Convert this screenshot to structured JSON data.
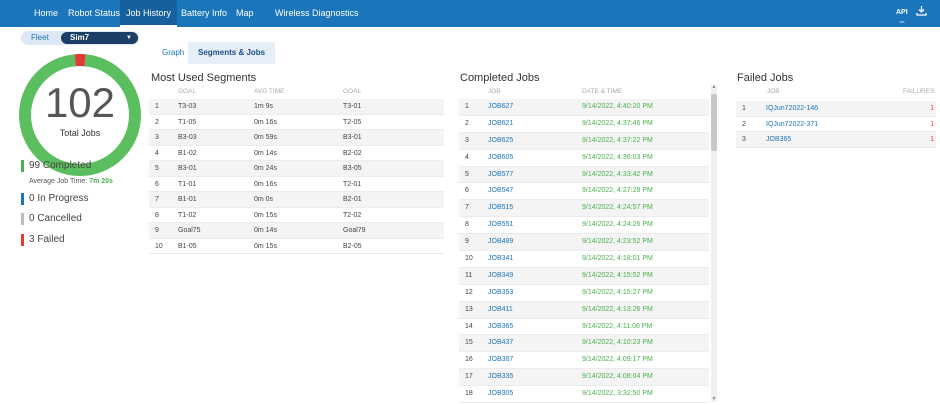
{
  "nav": {
    "tabs": [
      {
        "label": "Home"
      },
      {
        "label": "Robot Status"
      },
      {
        "label": "Job History"
      },
      {
        "label": "Battery Info"
      },
      {
        "label": "Map"
      },
      {
        "label": "Wireless Diagnostics"
      }
    ],
    "api_label": "API",
    "download_icon": "download-icon",
    "accent": "#1b75bb"
  },
  "fleet": {
    "label": "Fleet",
    "selected": "Sim7"
  },
  "summary": {
    "total": "102",
    "total_label": "Total Jobs",
    "completed_count": 99,
    "failed_count": 3,
    "completed": "99 Completed",
    "avg_label": "Average Job Time:",
    "avg_value": "7m 20s",
    "in_progress": "0 In Progress",
    "cancelled": "0 Cancelled",
    "failed": "3 Failed",
    "colors": {
      "completed": "#4caf50",
      "in_progress": "#1b75bb",
      "cancelled": "#bdbdbd",
      "failed": "#e53935"
    }
  },
  "subtabs": {
    "graph": "Graph",
    "segments": "Segments & Jobs"
  },
  "segments": {
    "title": "Most Used Segments",
    "headers": {
      "goal1": "GOAL",
      "avg": "AVG TIME",
      "goal2": "GOAL"
    },
    "rows": [
      {
        "n": "1",
        "from": "T3-03",
        "avg": "1m 9s",
        "to": "T3-01"
      },
      {
        "n": "2",
        "from": "T1-05",
        "avg": "0m 16s",
        "to": "T2-05"
      },
      {
        "n": "3",
        "from": "B3-03",
        "avg": "0m 59s",
        "to": "B3-01"
      },
      {
        "n": "4",
        "from": "B1-02",
        "avg": "0m 14s",
        "to": "B2-02"
      },
      {
        "n": "5",
        "from": "B3-01",
        "avg": "0m 24s",
        "to": "B3-05"
      },
      {
        "n": "6",
        "from": "T1-01",
        "avg": "0m 16s",
        "to": "T2-01"
      },
      {
        "n": "7",
        "from": "B1-01",
        "avg": "0m 0s",
        "to": "B2-01"
      },
      {
        "n": "8",
        "from": "T1-02",
        "avg": "0m 15s",
        "to": "T2-02"
      },
      {
        "n": "9",
        "from": "Goal75",
        "avg": "0m 14s",
        "to": "Goal79"
      },
      {
        "n": "10",
        "from": "B1-05",
        "avg": "0m 15s",
        "to": "B2-05"
      }
    ]
  },
  "completed_jobs": {
    "title": "Completed Jobs",
    "headers": {
      "job": "JOB",
      "date": "DATE & TIME"
    },
    "rows": [
      {
        "n": "1",
        "job": "JOB627",
        "date": "9/14/2022, 4:40:20 PM"
      },
      {
        "n": "2",
        "job": "JOB621",
        "date": "9/14/2022, 4:37:46 PM"
      },
      {
        "n": "3",
        "job": "JOB625",
        "date": "9/14/2022, 4:37:22 PM"
      },
      {
        "n": "4",
        "job": "JOB605",
        "date": "9/14/2022, 4:36:03 PM"
      },
      {
        "n": "5",
        "job": "JOB577",
        "date": "9/14/2022, 4:33:42 PM"
      },
      {
        "n": "6",
        "job": "JOB547",
        "date": "9/14/2022, 4:27:28 PM"
      },
      {
        "n": "7",
        "job": "JOB515",
        "date": "9/14/2022, 4:24:57 PM"
      },
      {
        "n": "8",
        "job": "JOB551",
        "date": "9/14/2022, 4:24:26 PM"
      },
      {
        "n": "9",
        "job": "JOB489",
        "date": "9/14/2022, 4:23:52 PM"
      },
      {
        "n": "10",
        "job": "JOB341",
        "date": "9/14/2022, 4:18:01 PM"
      },
      {
        "n": "11",
        "job": "JOB349",
        "date": "9/14/2022, 4:15:52 PM"
      },
      {
        "n": "12",
        "job": "JOB353",
        "date": "9/14/2022, 4:15:27 PM"
      },
      {
        "n": "13",
        "job": "JOB411",
        "date": "9/14/2022, 4:13:26 PM"
      },
      {
        "n": "14",
        "job": "JOB365",
        "date": "9/14/2022, 4:11:08 PM"
      },
      {
        "n": "15",
        "job": "JOB437",
        "date": "9/14/2022, 4:10:23 PM"
      },
      {
        "n": "16",
        "job": "JOB387",
        "date": "9/14/2022, 4:09:17 PM"
      },
      {
        "n": "17",
        "job": "JOB335",
        "date": "9/14/2022, 4:08:04 PM"
      },
      {
        "n": "18",
        "job": "JOB305",
        "date": "9/14/2022, 3:32:50 PM"
      }
    ]
  },
  "failed_jobs": {
    "title": "Failed Jobs",
    "headers": {
      "job": "JOB",
      "failures": "FAILURES"
    },
    "rows": [
      {
        "n": "1",
        "job": "IQJun72022-146",
        "failures": "1"
      },
      {
        "n": "2",
        "job": "IQJun72022-371",
        "failures": "1"
      },
      {
        "n": "3",
        "job": "JOB365",
        "failures": "1"
      }
    ]
  }
}
